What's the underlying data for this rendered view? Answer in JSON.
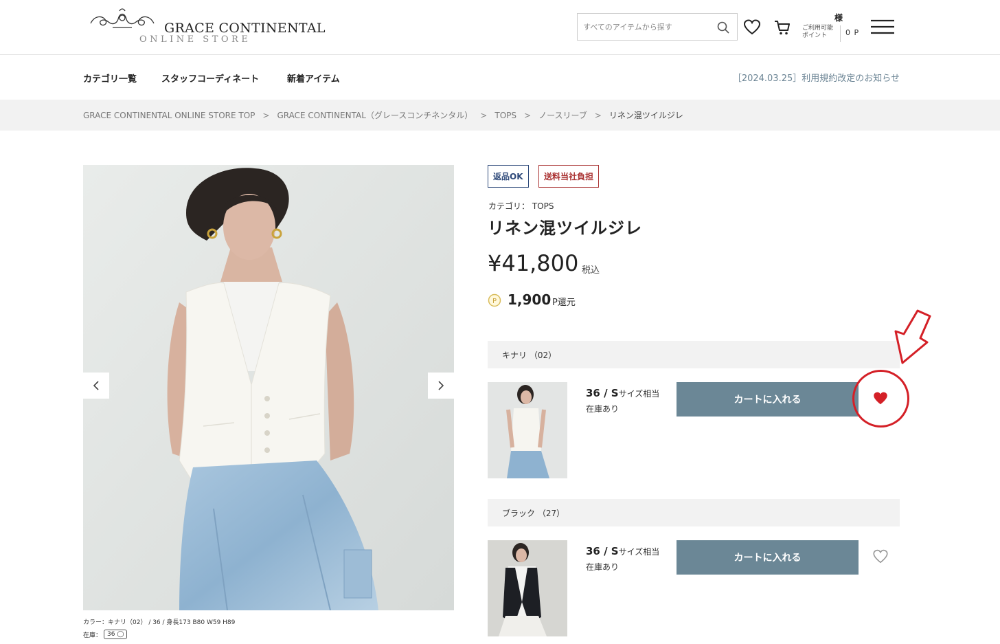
{
  "header": {
    "logo_title": "GRACE CONTINENTAL",
    "logo_sub": "ONLINE STORE",
    "search_placeholder": "すべてのアイテムから探す",
    "user_name": "様",
    "point_label": "ご利用可能ポイント",
    "point_value": "0 P"
  },
  "nav": {
    "items": [
      "カテゴリ一覧",
      "スタッフコーディネート",
      "新着アイテム"
    ],
    "notice": "［2024.03.25］利用規約改定のお知らせ"
  },
  "breadcrumb": [
    "GRACE CONTINENTAL ONLINE STORE TOP",
    "GRACE CONTINENTAL（グレースコンチネンタル）",
    "TOPS",
    "ノースリーブ",
    "リネン混ツイルジレ"
  ],
  "breadcrumb_sep": ">",
  "product": {
    "badges": [
      "返品OK",
      "送料当社負担"
    ],
    "category": "カテゴリ：  TOPS",
    "title": "リネン混ツイルジレ",
    "price": "¥41,800",
    "tax": "税込",
    "points": "1,900",
    "points_unit": "P還元",
    "caption": "カラー：キナリ（02）  /  36  /  身長173 B80 W59 H89",
    "stock_label": "在庫：",
    "stock_chip": "36 ◯"
  },
  "variants": [
    {
      "color": "キナリ （02）",
      "size": "36 / S",
      "size_note": "サイズ相当",
      "stock": "在庫あり",
      "cart_label": "カートに入れる",
      "favorited": true
    },
    {
      "color": "ブラック （27）",
      "size": "36 / S",
      "size_note": "サイズ相当",
      "stock": "在庫あり",
      "cart_label": "カートに入れる",
      "favorited": false
    }
  ],
  "colors": {
    "accent": "#6b8796",
    "annotation": "#d42027",
    "heart_active": "#d42027"
  }
}
